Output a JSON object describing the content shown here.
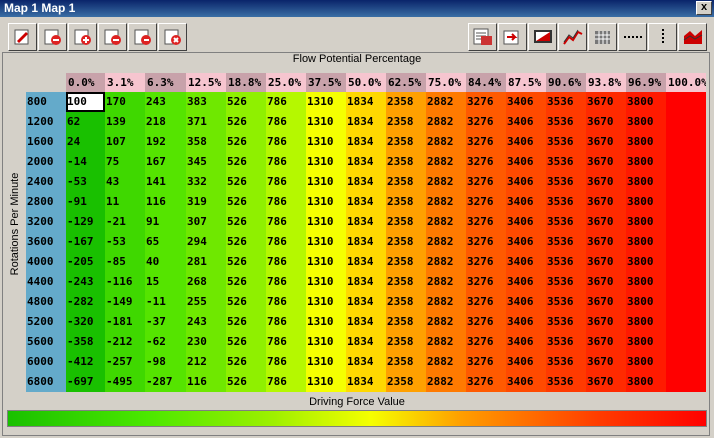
{
  "window": {
    "title": "Map 1 Map 1",
    "close_glyph": "x"
  },
  "toolbar": {
    "left_buttons": [
      {
        "name": "edit-icon"
      },
      {
        "name": "insert-left-icon"
      },
      {
        "name": "add-cells-icon"
      },
      {
        "name": "remove-cells-icon"
      },
      {
        "name": "delete-left-icon"
      },
      {
        "name": "clear-icon"
      }
    ],
    "right_buttons": [
      {
        "name": "table-view-icon"
      },
      {
        "name": "import-icon"
      },
      {
        "name": "display-icon"
      },
      {
        "name": "line-graph-icon"
      },
      {
        "name": "grid-icon"
      },
      {
        "name": "horizontal-line-icon"
      },
      {
        "name": "vertical-line-icon"
      },
      {
        "name": "3d-surface-icon"
      }
    ]
  },
  "table": {
    "x_title": "Flow Potential Percentage",
    "y_title": "Rotations Per Minute",
    "footer_title": "Driving Force Value",
    "columns": [
      "0.0%",
      "3.1%",
      "6.3%",
      "12.5%",
      "18.8%",
      "25.0%",
      "37.5%",
      "50.0%",
      "62.5%",
      "75.0%",
      "84.4%",
      "87.5%",
      "90.6%",
      "93.8%",
      "96.9%",
      "100.0%"
    ],
    "rows": [
      {
        "rpm": "800",
        "values": [
          "100",
          "170",
          "243",
          "383",
          "526",
          "786",
          "1310",
          "1834",
          "2358",
          "2882",
          "3276",
          "3406",
          "3536",
          "3670",
          "3800"
        ]
      },
      {
        "rpm": "1200",
        "values": [
          "62",
          "139",
          "218",
          "371",
          "526",
          "786",
          "1310",
          "1834",
          "2358",
          "2882",
          "3276",
          "3406",
          "3536",
          "3670",
          "3800"
        ]
      },
      {
        "rpm": "1600",
        "values": [
          "24",
          "107",
          "192",
          "358",
          "526",
          "786",
          "1310",
          "1834",
          "2358",
          "2882",
          "3276",
          "3406",
          "3536",
          "3670",
          "3800"
        ]
      },
      {
        "rpm": "2000",
        "values": [
          "-14",
          "75",
          "167",
          "345",
          "526",
          "786",
          "1310",
          "1834",
          "2358",
          "2882",
          "3276",
          "3406",
          "3536",
          "3670",
          "3800"
        ]
      },
      {
        "rpm": "2400",
        "values": [
          "-53",
          "43",
          "141",
          "332",
          "526",
          "786",
          "1310",
          "1834",
          "2358",
          "2882",
          "3276",
          "3406",
          "3536",
          "3670",
          "3800"
        ]
      },
      {
        "rpm": "2800",
        "values": [
          "-91",
          "11",
          "116",
          "319",
          "526",
          "786",
          "1310",
          "1834",
          "2358",
          "2882",
          "3276",
          "3406",
          "3536",
          "3670",
          "3800"
        ]
      },
      {
        "rpm": "3200",
        "values": [
          "-129",
          "-21",
          "91",
          "307",
          "526",
          "786",
          "1310",
          "1834",
          "2358",
          "2882",
          "3276",
          "3406",
          "3536",
          "3670",
          "3800"
        ]
      },
      {
        "rpm": "3600",
        "values": [
          "-167",
          "-53",
          "65",
          "294",
          "526",
          "786",
          "1310",
          "1834",
          "2358",
          "2882",
          "3276",
          "3406",
          "3536",
          "3670",
          "3800"
        ]
      },
      {
        "rpm": "4000",
        "values": [
          "-205",
          "-85",
          "40",
          "281",
          "526",
          "786",
          "1310",
          "1834",
          "2358",
          "2882",
          "3276",
          "3406",
          "3536",
          "3670",
          "3800"
        ]
      },
      {
        "rpm": "4400",
        "values": [
          "-243",
          "-116",
          "15",
          "268",
          "526",
          "786",
          "1310",
          "1834",
          "2358",
          "2882",
          "3276",
          "3406",
          "3536",
          "3670",
          "3800"
        ]
      },
      {
        "rpm": "4800",
        "values": [
          "-282",
          "-149",
          "-11",
          "255",
          "526",
          "786",
          "1310",
          "1834",
          "2358",
          "2882",
          "3276",
          "3406",
          "3536",
          "3670",
          "3800"
        ]
      },
      {
        "rpm": "5200",
        "values": [
          "-320",
          "-181",
          "-37",
          "243",
          "526",
          "786",
          "1310",
          "1834",
          "2358",
          "2882",
          "3276",
          "3406",
          "3536",
          "3670",
          "3800"
        ]
      },
      {
        "rpm": "5600",
        "values": [
          "-358",
          "-212",
          "-62",
          "230",
          "526",
          "786",
          "1310",
          "1834",
          "2358",
          "2882",
          "3276",
          "3406",
          "3536",
          "3670",
          "3800"
        ]
      },
      {
        "rpm": "6000",
        "values": [
          "-412",
          "-257",
          "-98",
          "212",
          "526",
          "786",
          "1310",
          "1834",
          "2358",
          "2882",
          "3276",
          "3406",
          "3536",
          "3670",
          "3800"
        ]
      },
      {
        "rpm": "6800",
        "values": [
          "-697",
          "-495",
          "-287",
          "116",
          "526",
          "786",
          "1310",
          "1834",
          "2358",
          "2882",
          "3276",
          "3406",
          "3536",
          "3670",
          "3800"
        ]
      }
    ],
    "column_colors": [
      "#19c000",
      "#3fd800",
      "#55e400",
      "#6fe800",
      "#8ff000",
      "#b5f800",
      "#f5ff00",
      "#ffd800",
      "#ffa000",
      "#ff7a00",
      "#ff5a00",
      "#ff4a00",
      "#ff3a00",
      "#ff2a00",
      "#ff1a00"
    ],
    "header_pink": "#f6c5cf",
    "header_mauve": "#c8a2aa",
    "rowhead_color": "#64aaca",
    "selected_cell": {
      "row": 0,
      "col": 0
    }
  }
}
